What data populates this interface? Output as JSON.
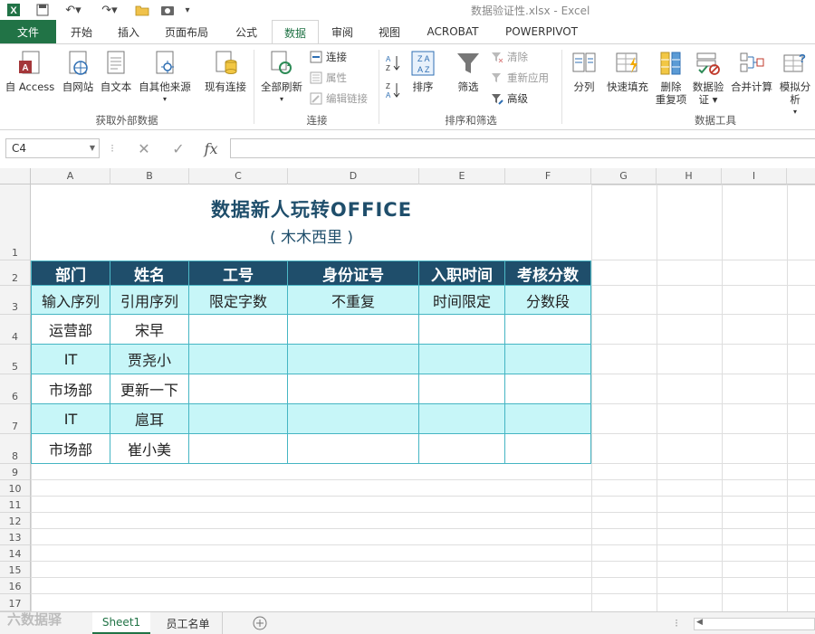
{
  "window": {
    "title": "数据验证性.xlsx - Excel"
  },
  "tabs": [
    "开始",
    "插入",
    "页面布局",
    "公式",
    "数据",
    "审阅",
    "视图",
    "ACROBAT",
    "POWERPIVOT"
  ],
  "file_tab": "文件",
  "active_tab": "数据",
  "ribbon": {
    "ext_data": {
      "access": "自 Access",
      "web": "自网站",
      "text": "自文本",
      "other": "自其他来源",
      "existing": "现有连接",
      "group": "获取外部数据"
    },
    "connections": {
      "refresh_all": "全部刷新",
      "connect": "连接",
      "properties": "属性",
      "edit_links": "编辑链接",
      "group": "连接"
    },
    "sort_filter": {
      "sort": "排序",
      "filter": "筛选",
      "clear": "清除",
      "reapply": "重新应用",
      "advanced": "高级",
      "group": "排序和筛选"
    },
    "tools": {
      "split": "分列",
      "flash_fill": "快速填充",
      "remove_dup_1": "删除",
      "remove_dup_2": "重复项",
      "validate_1": "数据验",
      "validate_2": "证 ▾",
      "consolidate": "合并计算",
      "whatif": "模拟分析",
      "group": "数据工具"
    }
  },
  "formula_bar": {
    "name_box": "C4",
    "fx": "fx",
    "value": ""
  },
  "columns": [
    "A",
    "B",
    "C",
    "D",
    "E",
    "F",
    "G",
    "H",
    "I"
  ],
  "rows": [
    "1",
    "2",
    "3",
    "4",
    "5",
    "6",
    "7",
    "8",
    "9",
    "10",
    "11",
    "12",
    "13",
    "14",
    "15",
    "16",
    "17"
  ],
  "sheet": {
    "title": "数据新人玩转OFFICE",
    "subtitle": "( 木木西里 )",
    "headers": [
      "部门",
      "姓名",
      "工号",
      "身份证号",
      "入职时间",
      "考核分数"
    ],
    "rules": [
      "输入序列",
      "引用序列",
      "限定字数",
      "不重复",
      "时间限定",
      "分数段"
    ],
    "data": [
      [
        "运营部",
        "宋早"
      ],
      [
        "IT",
        "贾尧小"
      ],
      [
        "市场部",
        "更新一下"
      ],
      [
        "IT",
        "扈耳"
      ],
      [
        "市场部",
        "崔小美"
      ]
    ]
  },
  "sheet_tabs": [
    "Sheet1",
    "员工名单"
  ],
  "watermark": "六数据驿"
}
